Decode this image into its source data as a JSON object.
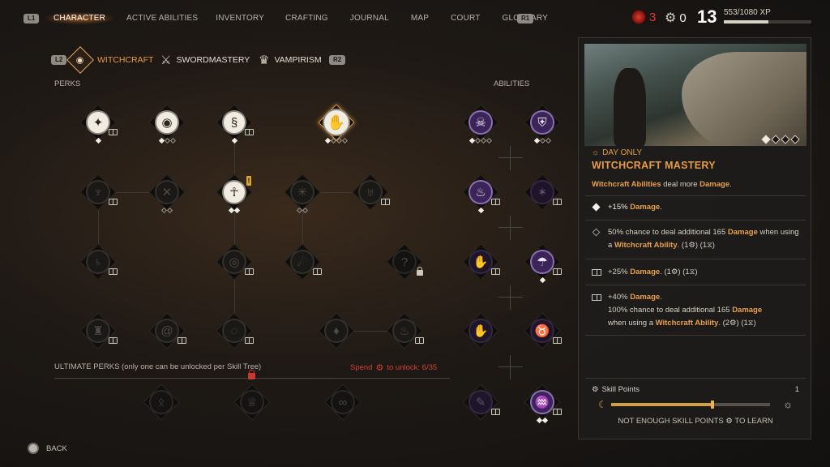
{
  "topbar": {
    "left_button": "L1",
    "right_button": "R1",
    "tabs": [
      "CHARACTER",
      "ACTIVE ABILITIES",
      "INVENTORY",
      "CRAFTING",
      "JOURNAL",
      "MAP",
      "COURT",
      "GLOSSARY"
    ],
    "active_tab": "CHARACTER",
    "blood_count": "3",
    "skill_point_count": "0",
    "level": "13",
    "xp_text": "553/1080 XP",
    "xp_progress_fraction": 0.512
  },
  "tree_tabs": {
    "left_button": "L2",
    "right_button": "R2",
    "items": [
      {
        "label": "WITCHCRAFT",
        "icon": "witchcraft-eye-icon",
        "active": true
      },
      {
        "label": "SWORDMASTERY",
        "icon": "sword-icon",
        "active": false
      },
      {
        "label": "VAMPIRISM",
        "icon": "vampire-icon",
        "active": false
      }
    ]
  },
  "labels": {
    "perks": "PERKS",
    "abilities": "ABILITIES",
    "ultimate": "ULTIMATE PERKS (only one can be unlocked per Skill Tree)",
    "spend_prefix": "Spend",
    "spend_suffix": "to unlock: 6/35",
    "back": "BACK"
  },
  "detail": {
    "tag": "DAY ONLY",
    "title": "WITCHCRAFT MASTERY",
    "desc_a": "Witchcraft Abilities",
    "desc_b": " deal more ",
    "desc_c": "Damage",
    "desc_d": ".",
    "ranks": {
      "r1_a": "+15% ",
      "r1_b": "Damage",
      "r1_c": ".",
      "r2_a": "50% chance to deal additional 165 ",
      "r2_b": "Damage",
      "r2_c": " when using a ",
      "r2_d": "Witchcraft Ability",
      "r2_e": ". (1⚙) (1⧖)",
      "r3_a": "+25% ",
      "r3_b": "Damage",
      "r3_c": ". (1⚙) (1⧖)",
      "r4_a": "+40% ",
      "r4_b": "Damage",
      "r4_c": ".",
      "r4_d": "100% chance to deal additional 165 ",
      "r4_e": "Damage",
      "r4_f": "when using a ",
      "r4_g": "Witchcraft Ability",
      "r4_h": ". (2⚙) (1⧖)"
    },
    "skill_points_label": "Skill Points",
    "skill_points_value": "1",
    "cycle_progress_fraction": 0.64,
    "learn_a": "NOT ENOUGH SKILL POINTS",
    "learn_b": "TO LEARN"
  },
  "colors": {
    "accent_orange": "#e89b45",
    "alert_red": "#d2403a",
    "ability_purple": "#3b2457"
  }
}
